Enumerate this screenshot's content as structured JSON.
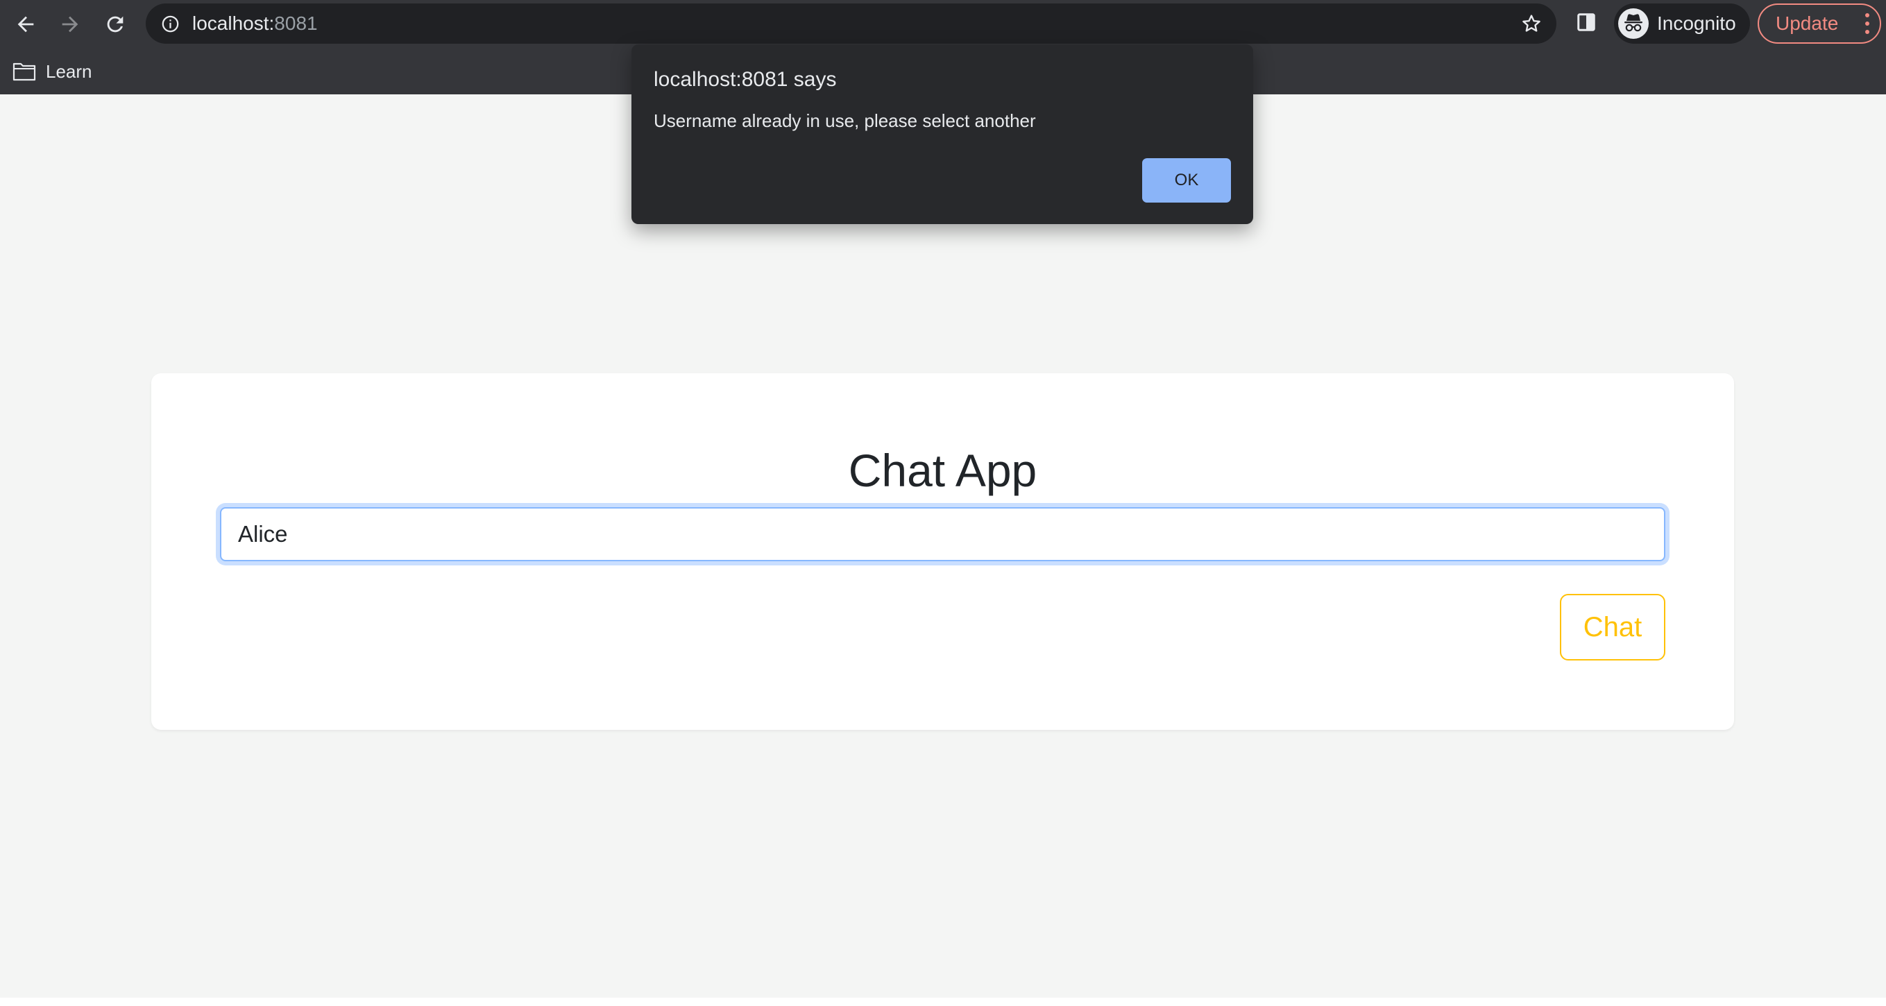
{
  "browser": {
    "url_host": "localhost:",
    "url_port": "8081",
    "profile_label": "Incognito",
    "update_label": "Update",
    "bookmarks": [
      {
        "label": "Learn",
        "icon": "folder-icon"
      }
    ]
  },
  "app": {
    "title": "Chat App",
    "username_value": "Alice",
    "chat_button_label": "Chat"
  },
  "dialog": {
    "heading": "localhost:8081 says",
    "message": "Username already in use, please select another",
    "ok_label": "OK"
  },
  "colors": {
    "chrome_bg": "#35363a",
    "page_bg": "#f4f5f4",
    "accent_blue": "#8ab4f8",
    "chat_button": "#ffc107",
    "update_red": "#f28b82"
  }
}
